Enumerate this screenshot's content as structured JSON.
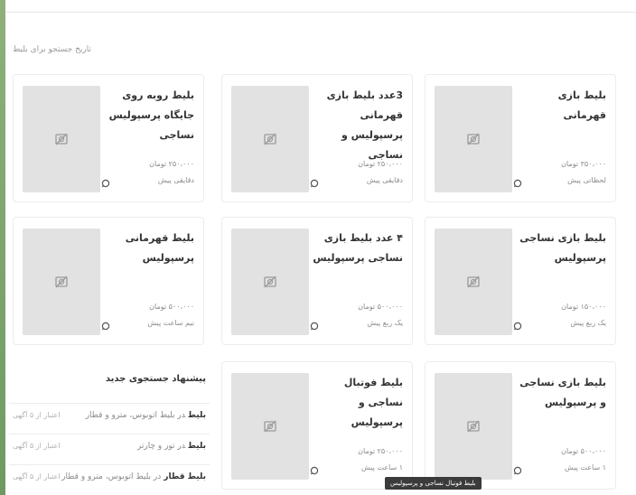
{
  "history_title": "تاریخ جستجو برای بلیط",
  "cards": [
    {
      "title": "بلیط بازی قهرمانی",
      "price": "۳۵۰،۰۰۰ تومان",
      "time": "لحظاتی پیش"
    },
    {
      "title": "3عدد بلیط بازی قهرمانی پرسپولیس و نساجی",
      "price": "۲۵۰،۰۰۰ تومان",
      "time": "دقایقی پیش"
    },
    {
      "title": "بلیط روبه روی جایگاه پرسپولیس نساجی",
      "price": "۲۵۰،۰۰۰ تومان",
      "time": "دقایقی پیش"
    },
    {
      "title": "بلیط بازی نساجی پرسپولیس",
      "price": "۱۵۰،۰۰۰ تومان",
      "time": "یک ربع پیش"
    },
    {
      "title": "۴ عدد بلیط بازی نساجی پرسپولیس",
      "price": "۵۰۰،۰۰۰ تومان",
      "time": "یک ربع پیش"
    },
    {
      "title": "بلیط قهرمانی پرسپولیس",
      "price": "۵۰۰،۰۰۰ تومان",
      "time": "نیم ساعت پیش"
    },
    {
      "title": "بلیط بازی نساجی و پرسپولیس",
      "price": "۵۰۰،۰۰۰ تومان",
      "time": "۱ ساعت پیش"
    },
    {
      "title": "بلیط فوتبال نساجی و پرسپولیس",
      "price": "۲۵۰،۰۰۰ تومان",
      "time": "۱ ساعت پیش"
    }
  ],
  "suggestions": {
    "title": "پیشنهاد جستجوی جدید",
    "items": [
      {
        "term": "بلیط",
        "category": "در بلیط اتوبوس، مترو و قطار",
        "note": "اعتبار از ۵ آگهی"
      },
      {
        "term": "بلیط",
        "category": "در تور و چارتر",
        "note": "اعتبار از ۵ آگهی"
      },
      {
        "term": "بلیط قطار",
        "category": "در بلیط اتوبوس، مترو و قطار",
        "note": "اعتبار از ۵ آگهی"
      }
    ]
  },
  "tooltip": "بلیط فوتبال نساجی و پرسپولیس",
  "colors": {
    "accent": "#6e9a62",
    "placeholder": "#e2e2e2"
  }
}
